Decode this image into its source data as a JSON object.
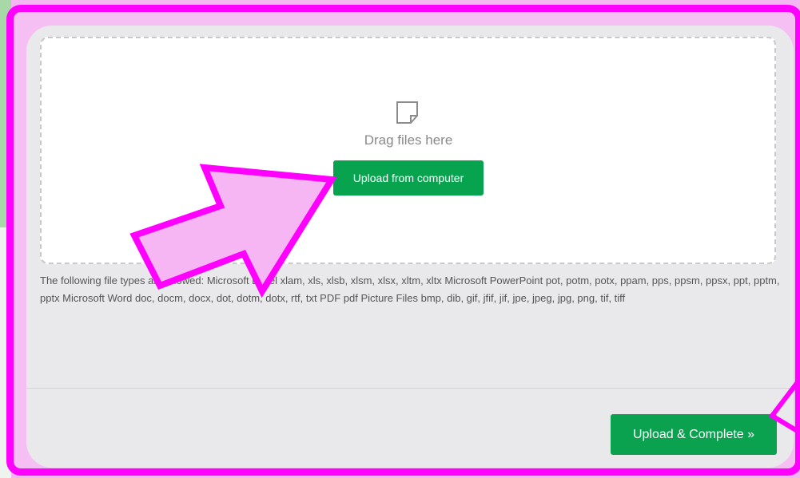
{
  "colors": {
    "frame": "#ff00ff",
    "overlay_fill": "#f6b5f3",
    "primary_button": "#07a34f",
    "card_background": "#e9e9eb"
  },
  "icons": {
    "file": "file-icon",
    "arrow_annotation": "arrow-icon"
  },
  "dropzone": {
    "drag_text": "Drag files here",
    "upload_button_label": "Upload from computer"
  },
  "allowed_file_types_text": "The following file types are allowed: Microsoft Excel xlam, xls, xlsb, xlsm, xlsx, xltm, xltx Microsoft PowerPoint pot, potm, potx, ppam, pps, ppsm, ppsx, ppt, pptm, pptx Microsoft Word doc, docm, docx, dot, dotm, dotx, rtf, txt PDF pdf Picture Files bmp, dib, gif, jfif, jif, jpe, jpeg, jpg, png, tif, tiff",
  "footer": {
    "complete_button_label": "Upload & Complete »"
  }
}
